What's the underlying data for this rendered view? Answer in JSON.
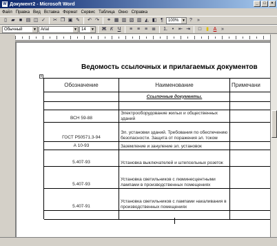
{
  "window": {
    "title": "Документ2 - Microsoft Word",
    "app_icon": "W",
    "btn_min": "_",
    "btn_max": "□",
    "btn_close": "×"
  },
  "menu": [
    "Файл",
    "Правка",
    "Вид",
    "Вставка",
    "Формат",
    "Сервис",
    "Таблица",
    "Окно",
    "Справка"
  ],
  "toolbar": {
    "zoom": "100%",
    "style": "Обычный",
    "font": "Arial",
    "size": "14",
    "help_icon_label": "?"
  },
  "document": {
    "title": "Ведомость ссылочных и прилагаемых документов",
    "headers": [
      "Обозначение",
      "Наименование",
      "Примечани"
    ],
    "section": "Ссылочные документы.",
    "rows": [
      {
        "code": "ВСН 59-88",
        "name": "Электрооборудование жилых и общественных зданий"
      },
      {
        "code": "ГОСТ Р50571.3-94",
        "name": "Эл. установки зданий. Требования по обеспечению безопасности. Защита от поражения эл. током"
      },
      {
        "code": "А 10-93",
        "name": "Заземление и зануление эл. установок"
      },
      {
        "code": "5.407-93",
        "name": "Установка выключателей и штепсельных розеток"
      },
      {
        "code": "5.407-93",
        "name": "Установка светильников с люминесцентными лампами в производственных помещениях"
      },
      {
        "code": "5.407-91",
        "name": "Установка светильников с лампами накаливания в производственных помещениях"
      }
    ]
  }
}
